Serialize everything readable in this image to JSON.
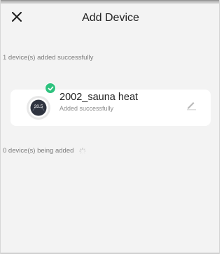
{
  "header": {
    "title": "Add Device",
    "close_icon": "close-icon"
  },
  "success_section": {
    "label": "1 device(s) added successfully",
    "devices": [
      {
        "name": "2002_sauna heat",
        "status": "Added successfully",
        "thermostat_reading": "20.5",
        "icons": {
          "badge": "check-badge-icon",
          "edit": "edit-pencil-icon"
        }
      }
    ]
  },
  "adding_section": {
    "label": "0 device(s) being added",
    "icon": "loading-spinner-icon"
  },
  "colors": {
    "background": "#f3f3f3",
    "card": "#ffffff",
    "success_green": "#2ec27e",
    "text_primary": "#1f1f1f",
    "text_secondary": "#7c7c7c"
  }
}
